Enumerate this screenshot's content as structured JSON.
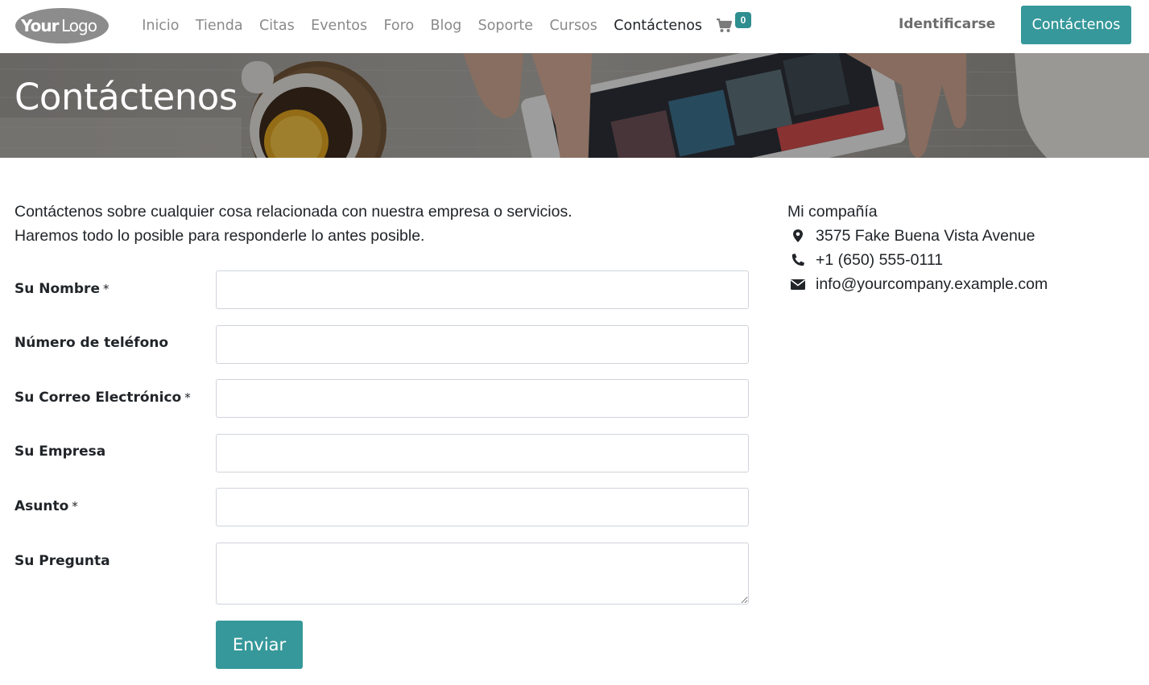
{
  "header": {
    "logo_text": "YourLogo",
    "nav": [
      "Inicio",
      "Tienda",
      "Citas",
      "Eventos",
      "Foro",
      "Blog",
      "Soporte",
      "Cursos",
      "Contáctenos"
    ],
    "cart_count": "0",
    "signin_label": "Identificarse",
    "cta_label": "Contáctenos"
  },
  "banner": {
    "title": "Contáctenos"
  },
  "intro": {
    "line1": "Contáctenos sobre cualquier cosa relacionada con nuestra empresa o servicios.",
    "line2": "Haremos todo lo posible para responderle lo antes posible."
  },
  "form": {
    "fields": [
      {
        "label": "Su Nombre",
        "required": true,
        "value": ""
      },
      {
        "label": "Número de teléfono",
        "required": false,
        "value": ""
      },
      {
        "label": "Su Correo Electrónico",
        "required": true,
        "value": ""
      },
      {
        "label": "Su Empresa",
        "required": false,
        "value": ""
      },
      {
        "label": "Asunto",
        "required": true,
        "value": ""
      },
      {
        "label": "Su Pregunta",
        "required": false,
        "value": ""
      }
    ],
    "required_mark": "*",
    "submit_label": "Enviar"
  },
  "company": {
    "name": "Mi compañía",
    "address": "3575 Fake Buena Vista Avenue",
    "phone": "+1 (650) 555-0111",
    "email": "info@yourcompany.example.com"
  },
  "colors": {
    "accent": "#36989a",
    "badge": "#2f8e8f",
    "nav_text": "#8a8a8a",
    "text": "#212529"
  },
  "icons": {
    "cart": "shopping-cart-icon",
    "address": "map-marker-icon",
    "phone": "phone-icon",
    "email": "envelope-icon"
  }
}
